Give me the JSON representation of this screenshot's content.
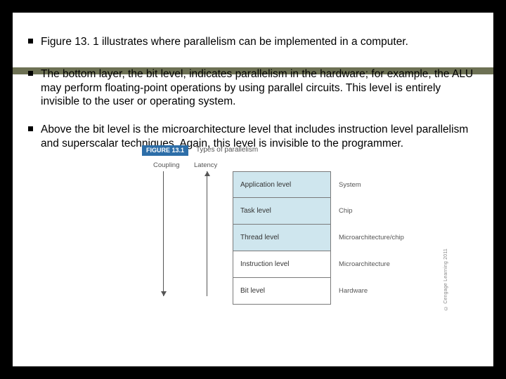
{
  "bullets": {
    "b0": "Figure 13. 1 illustrates where parallelism can be implemented in a computer.",
    "b1": "The bottom layer, the bit level, indicates parallelism in the hardware; for example, the ALU may perform floating-point operations by using parallel circuits. This level is entirely invisible to the user or operating system.",
    "b2": "Above the bit level is the microarchitecture level that includes instruction level parallelism and superscalar techniques. Again, this level is invisible to the programmer."
  },
  "figure": {
    "tag": "FIGURE 13.1",
    "caption": "Types of parallelism",
    "col_coupling": "Coupling",
    "col_latency": "Latency",
    "levels": [
      {
        "name": "Application level",
        "shaded": true,
        "right": "System"
      },
      {
        "name": "Task level",
        "shaded": true,
        "right": "Chip"
      },
      {
        "name": "Thread level",
        "shaded": true,
        "right": "Microarchitecture/chip"
      },
      {
        "name": "Instruction level",
        "shaded": false,
        "right": "Microarchitecture"
      },
      {
        "name": "Bit level",
        "shaded": false,
        "right": "Hardware"
      }
    ],
    "copyright": "© Cengage Learning 2011"
  }
}
